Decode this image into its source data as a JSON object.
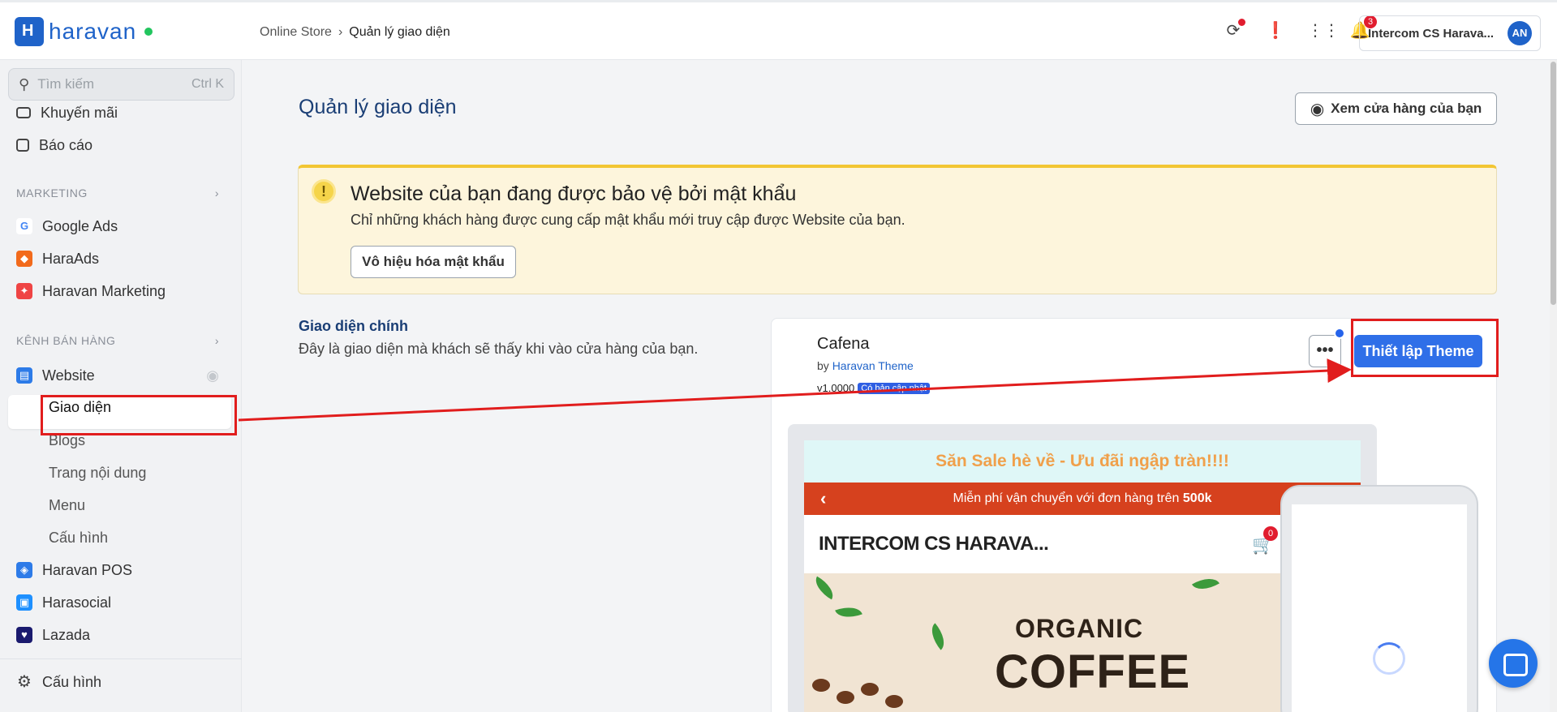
{
  "topbar": {
    "brand": "haravan",
    "breadcrumb": [
      "Online Store",
      "Quản lý giao diện"
    ],
    "notification_count": "3",
    "account_name": "Intercom CS Harava...",
    "avatar_initials": "AN"
  },
  "sidebar": {
    "search_placeholder": "Tìm kiếm",
    "search_shortcut": "Ctrl K",
    "items_top": [
      {
        "label": "Khuyến mãi",
        "icon": "gift-icon"
      },
      {
        "label": "Báo cáo",
        "icon": "chart-icon"
      }
    ],
    "marketing_header": "MARKETING",
    "marketing_items": [
      {
        "label": "Google Ads",
        "icon": "google-icon"
      },
      {
        "label": "HaraAds",
        "icon": "haraads-icon"
      },
      {
        "label": "Haravan Marketing",
        "icon": "marketing-icon"
      }
    ],
    "channels_header": "KÊNH BÁN HÀNG",
    "website_label": "Website",
    "website_sub": [
      "Giao diện",
      "Blogs",
      "Trang nội dung",
      "Menu",
      "Cấu hình"
    ],
    "channel_items": [
      {
        "label": "Haravan POS",
        "icon": "pos-icon"
      },
      {
        "label": "Harasocial",
        "icon": "harasocial-icon"
      },
      {
        "label": "Lazada",
        "icon": "lazada-icon"
      }
    ],
    "settings_label": "Cấu hình"
  },
  "main": {
    "title": "Quản lý giao diện",
    "view_store_label": "Xem cửa hàng của bạn",
    "alert": {
      "title": "Website của bạn đang được bảo vệ bởi mật khẩu",
      "description": "Chỉ những khách hàng được cung cấp mật khẩu mới truy cập được Website của bạn.",
      "button": "Vô hiệu hóa mật khẩu"
    },
    "theme_section": {
      "title": "Giao diện chính",
      "description": "Đây là giao diện mà khách sẽ thấy khi vào cửa hàng của bạn."
    },
    "theme_card": {
      "name": "Cafena",
      "by_prefix": "by",
      "author": "Haravan Theme",
      "version": "v1.0000",
      "version_badge": "Có bản cập nhật",
      "more_label": "•••",
      "setup_label": "Thiết lập Theme"
    },
    "preview": {
      "sale_banner": "Săn Sale hè về - Ưu đãi ngập tràn!!!!",
      "shipping_text": "Miễn phí vận chuyển với đơn hàng trên",
      "shipping_amount": "500k",
      "store_name": "INTERCOM CS HARAVA...",
      "cart_count": "0",
      "hero_line1": "ORGANIC",
      "hero_line2": "COFFEE"
    }
  },
  "colors": {
    "brand": "#1f63c9",
    "primary_button": "#2f6fe8",
    "alert_bg": "#fdf5dc",
    "annotation": "#e11d1d"
  }
}
